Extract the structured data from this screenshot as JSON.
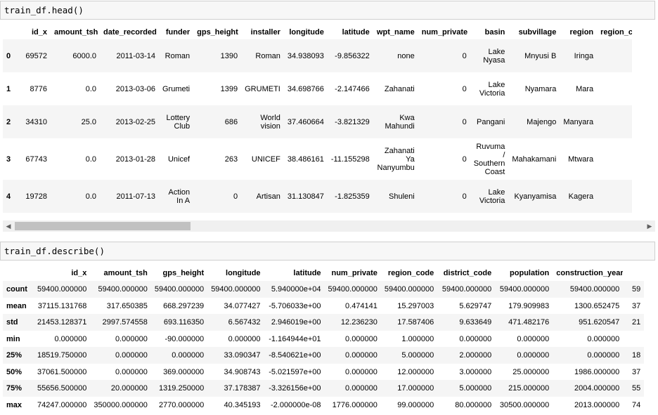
{
  "cells": [
    {
      "code": "train_df.head()"
    },
    {
      "code": "train_df.describe()"
    }
  ],
  "head_table": {
    "columns": [
      "",
      "id_x",
      "amount_tsh",
      "date_recorded",
      "funder",
      "gps_height",
      "installer",
      "longitude",
      "latitude",
      "wpt_name",
      "num_private",
      "basin",
      "subvillage",
      "region",
      "region_c"
    ],
    "rows": [
      {
        "index": "0",
        "cells": [
          "69572",
          "6000.0",
          "2011-03-14",
          "Roman",
          "1390",
          "Roman",
          "34.938093",
          "-9.856322",
          "none",
          "0",
          "Lake\nNyasa",
          "Mnyusi B",
          "Iringa",
          ""
        ]
      },
      {
        "index": "1",
        "cells": [
          "8776",
          "0.0",
          "2013-03-06",
          "Grumeti",
          "1399",
          "GRUMETI",
          "34.698766",
          "-2.147466",
          "Zahanati",
          "0",
          "Lake\nVictoria",
          "Nyamara",
          "Mara",
          ""
        ]
      },
      {
        "index": "2",
        "cells": [
          "34310",
          "25.0",
          "2013-02-25",
          "Lottery\nClub",
          "686",
          "World\nvision",
          "37.460664",
          "-3.821329",
          "Kwa\nMahundi",
          "0",
          "Pangani",
          "Majengo",
          "Manyara",
          ""
        ]
      },
      {
        "index": "3",
        "cells": [
          "67743",
          "0.0",
          "2013-01-28",
          "Unicef",
          "263",
          "UNICEF",
          "38.486161",
          "-11.155298",
          "Zahanati\nYa\nNanyumbu",
          "0",
          "Ruvuma\n/\nSouthern\nCoast",
          "Mahakamani",
          "Mtwara",
          ""
        ]
      },
      {
        "index": "4",
        "cells": [
          "19728",
          "0.0",
          "2011-07-13",
          "Action\nIn A",
          "0",
          "Artisan",
          "31.130847",
          "-1.825359",
          "Shuleni",
          "0",
          "Lake\nVictoria",
          "Kyanyamisa",
          "Kagera",
          ""
        ]
      }
    ]
  },
  "scrollbar": {
    "left_arrow": "◀",
    "right_arrow": "▶"
  },
  "describe_table": {
    "columns": [
      "",
      "id_x",
      "amount_tsh",
      "gps_height",
      "longitude",
      "latitude",
      "num_private",
      "region_code",
      "district_code",
      "population",
      "construction_year",
      ""
    ],
    "rows": [
      {
        "index": "count",
        "cells": [
          "59400.000000",
          "59400.000000",
          "59400.000000",
          "59400.000000",
          "5.940000e+04",
          "59400.000000",
          "59400.000000",
          "59400.000000",
          "59400.000000",
          "59400.000000",
          "59"
        ]
      },
      {
        "index": "mean",
        "cells": [
          "37115.131768",
          "317.650385",
          "668.297239",
          "34.077427",
          "-5.706033e+00",
          "0.474141",
          "15.297003",
          "5.629747",
          "179.909983",
          "1300.652475",
          "37"
        ]
      },
      {
        "index": "std",
        "cells": [
          "21453.128371",
          "2997.574558",
          "693.116350",
          "6.567432",
          "2.946019e+00",
          "12.236230",
          "17.587406",
          "9.633649",
          "471.482176",
          "951.620547",
          "21"
        ]
      },
      {
        "index": "min",
        "cells": [
          "0.000000",
          "0.000000",
          "-90.000000",
          "0.000000",
          "-1.164944e+01",
          "0.000000",
          "1.000000",
          "0.000000",
          "0.000000",
          "0.000000",
          ""
        ]
      },
      {
        "index": "25%",
        "cells": [
          "18519.750000",
          "0.000000",
          "0.000000",
          "33.090347",
          "-8.540621e+00",
          "0.000000",
          "5.000000",
          "2.000000",
          "0.000000",
          "0.000000",
          "18"
        ]
      },
      {
        "index": "50%",
        "cells": [
          "37061.500000",
          "0.000000",
          "369.000000",
          "34.908743",
          "-5.021597e+00",
          "0.000000",
          "12.000000",
          "3.000000",
          "25.000000",
          "1986.000000",
          "37"
        ]
      },
      {
        "index": "75%",
        "cells": [
          "55656.500000",
          "20.000000",
          "1319.250000",
          "37.178387",
          "-3.326156e+00",
          "0.000000",
          "17.000000",
          "5.000000",
          "215.000000",
          "2004.000000",
          "55"
        ]
      },
      {
        "index": "max",
        "cells": [
          "74247.000000",
          "350000.000000",
          "2770.000000",
          "40.345193",
          "-2.000000e-08",
          "1776.000000",
          "99.000000",
          "80.000000",
          "30500.000000",
          "2013.000000",
          "74"
        ]
      }
    ]
  }
}
